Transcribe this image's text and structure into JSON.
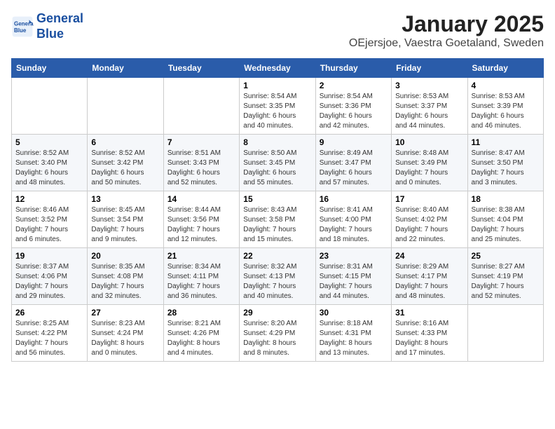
{
  "header": {
    "logo_line1": "General",
    "logo_line2": "Blue",
    "month": "January 2025",
    "location": "OEjersjoe, Vaestra Goetaland, Sweden"
  },
  "weekdays": [
    "Sunday",
    "Monday",
    "Tuesday",
    "Wednesday",
    "Thursday",
    "Friday",
    "Saturday"
  ],
  "weeks": [
    [
      {
        "day": "",
        "info": ""
      },
      {
        "day": "",
        "info": ""
      },
      {
        "day": "",
        "info": ""
      },
      {
        "day": "1",
        "info": "Sunrise: 8:54 AM\nSunset: 3:35 PM\nDaylight: 6 hours\nand 40 minutes."
      },
      {
        "day": "2",
        "info": "Sunrise: 8:54 AM\nSunset: 3:36 PM\nDaylight: 6 hours\nand 42 minutes."
      },
      {
        "day": "3",
        "info": "Sunrise: 8:53 AM\nSunset: 3:37 PM\nDaylight: 6 hours\nand 44 minutes."
      },
      {
        "day": "4",
        "info": "Sunrise: 8:53 AM\nSunset: 3:39 PM\nDaylight: 6 hours\nand 46 minutes."
      }
    ],
    [
      {
        "day": "5",
        "info": "Sunrise: 8:52 AM\nSunset: 3:40 PM\nDaylight: 6 hours\nand 48 minutes."
      },
      {
        "day": "6",
        "info": "Sunrise: 8:52 AM\nSunset: 3:42 PM\nDaylight: 6 hours\nand 50 minutes."
      },
      {
        "day": "7",
        "info": "Sunrise: 8:51 AM\nSunset: 3:43 PM\nDaylight: 6 hours\nand 52 minutes."
      },
      {
        "day": "8",
        "info": "Sunrise: 8:50 AM\nSunset: 3:45 PM\nDaylight: 6 hours\nand 55 minutes."
      },
      {
        "day": "9",
        "info": "Sunrise: 8:49 AM\nSunset: 3:47 PM\nDaylight: 6 hours\nand 57 minutes."
      },
      {
        "day": "10",
        "info": "Sunrise: 8:48 AM\nSunset: 3:49 PM\nDaylight: 7 hours\nand 0 minutes."
      },
      {
        "day": "11",
        "info": "Sunrise: 8:47 AM\nSunset: 3:50 PM\nDaylight: 7 hours\nand 3 minutes."
      }
    ],
    [
      {
        "day": "12",
        "info": "Sunrise: 8:46 AM\nSunset: 3:52 PM\nDaylight: 7 hours\nand 6 minutes."
      },
      {
        "day": "13",
        "info": "Sunrise: 8:45 AM\nSunset: 3:54 PM\nDaylight: 7 hours\nand 9 minutes."
      },
      {
        "day": "14",
        "info": "Sunrise: 8:44 AM\nSunset: 3:56 PM\nDaylight: 7 hours\nand 12 minutes."
      },
      {
        "day": "15",
        "info": "Sunrise: 8:43 AM\nSunset: 3:58 PM\nDaylight: 7 hours\nand 15 minutes."
      },
      {
        "day": "16",
        "info": "Sunrise: 8:41 AM\nSunset: 4:00 PM\nDaylight: 7 hours\nand 18 minutes."
      },
      {
        "day": "17",
        "info": "Sunrise: 8:40 AM\nSunset: 4:02 PM\nDaylight: 7 hours\nand 22 minutes."
      },
      {
        "day": "18",
        "info": "Sunrise: 8:38 AM\nSunset: 4:04 PM\nDaylight: 7 hours\nand 25 minutes."
      }
    ],
    [
      {
        "day": "19",
        "info": "Sunrise: 8:37 AM\nSunset: 4:06 PM\nDaylight: 7 hours\nand 29 minutes."
      },
      {
        "day": "20",
        "info": "Sunrise: 8:35 AM\nSunset: 4:08 PM\nDaylight: 7 hours\nand 32 minutes."
      },
      {
        "day": "21",
        "info": "Sunrise: 8:34 AM\nSunset: 4:11 PM\nDaylight: 7 hours\nand 36 minutes."
      },
      {
        "day": "22",
        "info": "Sunrise: 8:32 AM\nSunset: 4:13 PM\nDaylight: 7 hours\nand 40 minutes."
      },
      {
        "day": "23",
        "info": "Sunrise: 8:31 AM\nSunset: 4:15 PM\nDaylight: 7 hours\nand 44 minutes."
      },
      {
        "day": "24",
        "info": "Sunrise: 8:29 AM\nSunset: 4:17 PM\nDaylight: 7 hours\nand 48 minutes."
      },
      {
        "day": "25",
        "info": "Sunrise: 8:27 AM\nSunset: 4:19 PM\nDaylight: 7 hours\nand 52 minutes."
      }
    ],
    [
      {
        "day": "26",
        "info": "Sunrise: 8:25 AM\nSunset: 4:22 PM\nDaylight: 7 hours\nand 56 minutes."
      },
      {
        "day": "27",
        "info": "Sunrise: 8:23 AM\nSunset: 4:24 PM\nDaylight: 8 hours\nand 0 minutes."
      },
      {
        "day": "28",
        "info": "Sunrise: 8:21 AM\nSunset: 4:26 PM\nDaylight: 8 hours\nand 4 minutes."
      },
      {
        "day": "29",
        "info": "Sunrise: 8:20 AM\nSunset: 4:29 PM\nDaylight: 8 hours\nand 8 minutes."
      },
      {
        "day": "30",
        "info": "Sunrise: 8:18 AM\nSunset: 4:31 PM\nDaylight: 8 hours\nand 13 minutes."
      },
      {
        "day": "31",
        "info": "Sunrise: 8:16 AM\nSunset: 4:33 PM\nDaylight: 8 hours\nand 17 minutes."
      },
      {
        "day": "",
        "info": ""
      }
    ]
  ]
}
